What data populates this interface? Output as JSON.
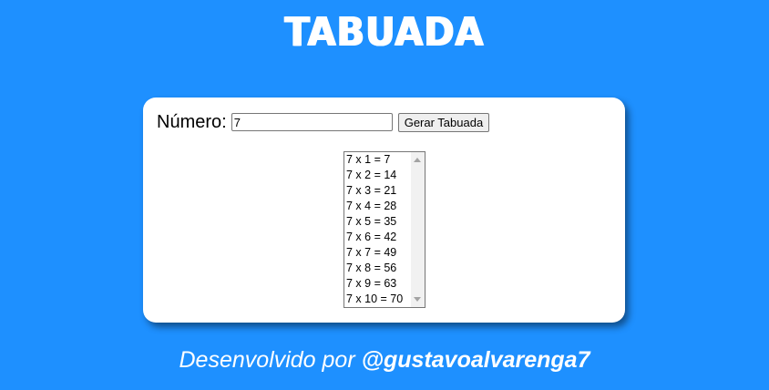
{
  "header": {
    "title": "TABUADA"
  },
  "form": {
    "number_label": "Número:",
    "number_value": "7",
    "generate_button_label": "Gerar Tabuada"
  },
  "table": {
    "options": [
      "7 x 1 = 7",
      "7 x 2 = 14",
      "7 x 3 = 21",
      "7 x 4 = 28",
      "7 x 5 = 35",
      "7 x 6 = 42",
      "7 x 7 = 49",
      "7 x 8 = 56",
      "7 x 9 = 63",
      "7 x 10 = 70"
    ]
  },
  "footer": {
    "prefix": "Desenvolvido por ",
    "author": "@gustavoalvarenga7"
  },
  "colors": {
    "background": "#1e90ff",
    "card": "#ffffff",
    "text_light": "#ffffff"
  },
  "icons": {
    "scroll_up": "chevron-up-icon",
    "scroll_down": "chevron-down-icon"
  }
}
